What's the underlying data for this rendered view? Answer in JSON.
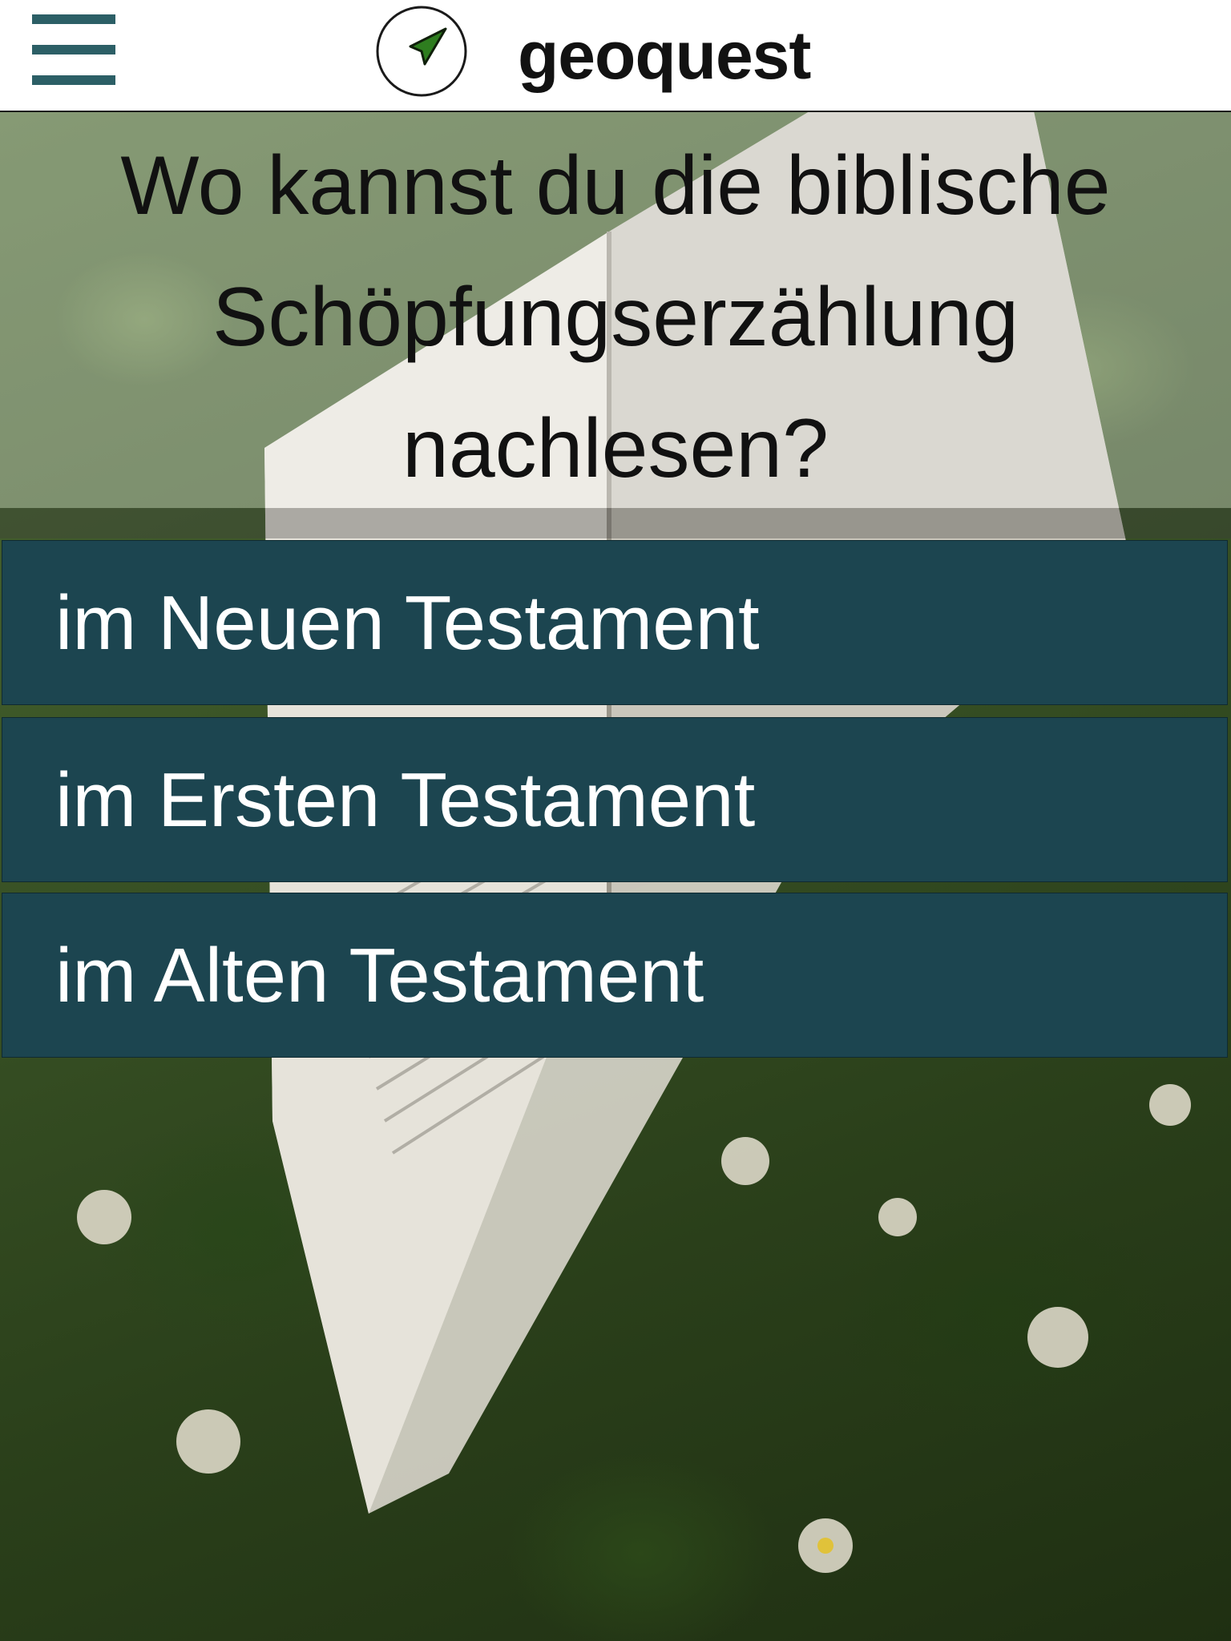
{
  "header": {
    "app_name": "geoquest",
    "menu_icon": "hamburger-menu-icon",
    "logo_icon": "navigation-arrow-icon",
    "accent_color": "#2c5f66",
    "logo_arrow_color": "#2e7d1f"
  },
  "question": {
    "line1": "Wo kannst du die biblische",
    "line2": "Schöpfungserzählung",
    "line3": "nachlesen?"
  },
  "answers": [
    {
      "label": "im Neuen Testament"
    },
    {
      "label": "im Ersten Testament"
    },
    {
      "label": "im Alten Testament"
    }
  ],
  "answer_color": "#1c4550"
}
